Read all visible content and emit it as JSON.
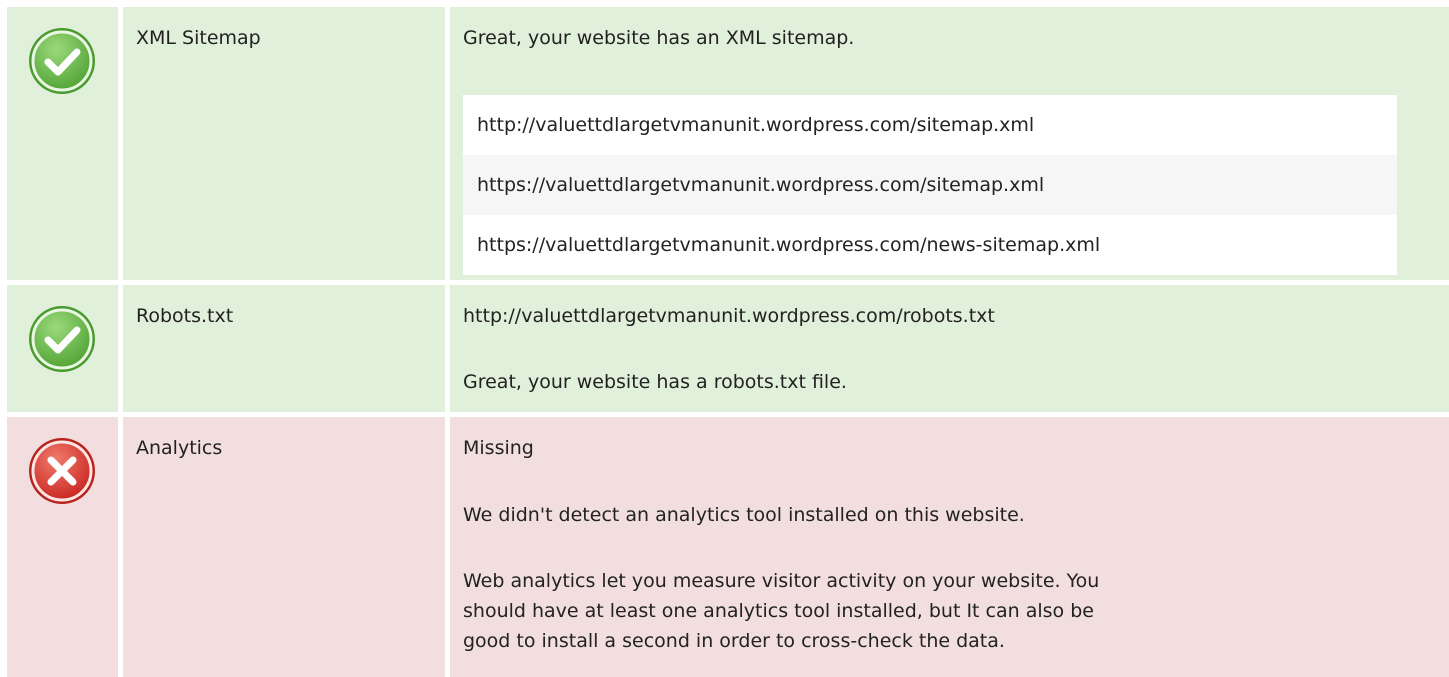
{
  "colors": {
    "pass_bg": "#e0f0da",
    "fail_bg": "#f2dedf",
    "pass_icon": "#62b545",
    "fail_icon": "#d9302b"
  },
  "xml_sitemap": {
    "icon": "check-circle-icon",
    "name": "XML Sitemap",
    "message": "Great, your website has an XML sitemap.",
    "urls": [
      "http://valuettdlargetvmanunit.wordpress.com/sitemap.xml",
      "https://valuettdlargetvmanunit.wordpress.com/sitemap.xml",
      "https://valuettdlargetvmanunit.wordpress.com/news-sitemap.xml"
    ]
  },
  "robots": {
    "icon": "check-circle-icon",
    "name": "Robots.txt",
    "url": "http://valuettdlargetvmanunit.wordpress.com/robots.txt",
    "message": "Great, your website has a robots.txt file."
  },
  "analytics": {
    "icon": "x-circle-icon",
    "name": "Analytics",
    "status": "Missing",
    "message": "We didn't detect an analytics tool installed on this website.",
    "advice_lines": [
      "Web analytics let you measure visitor activity on your website. You",
      "should have at least one analytics tool installed, but It can also be",
      "good to install a second in order to cross-check the data."
    ]
  }
}
